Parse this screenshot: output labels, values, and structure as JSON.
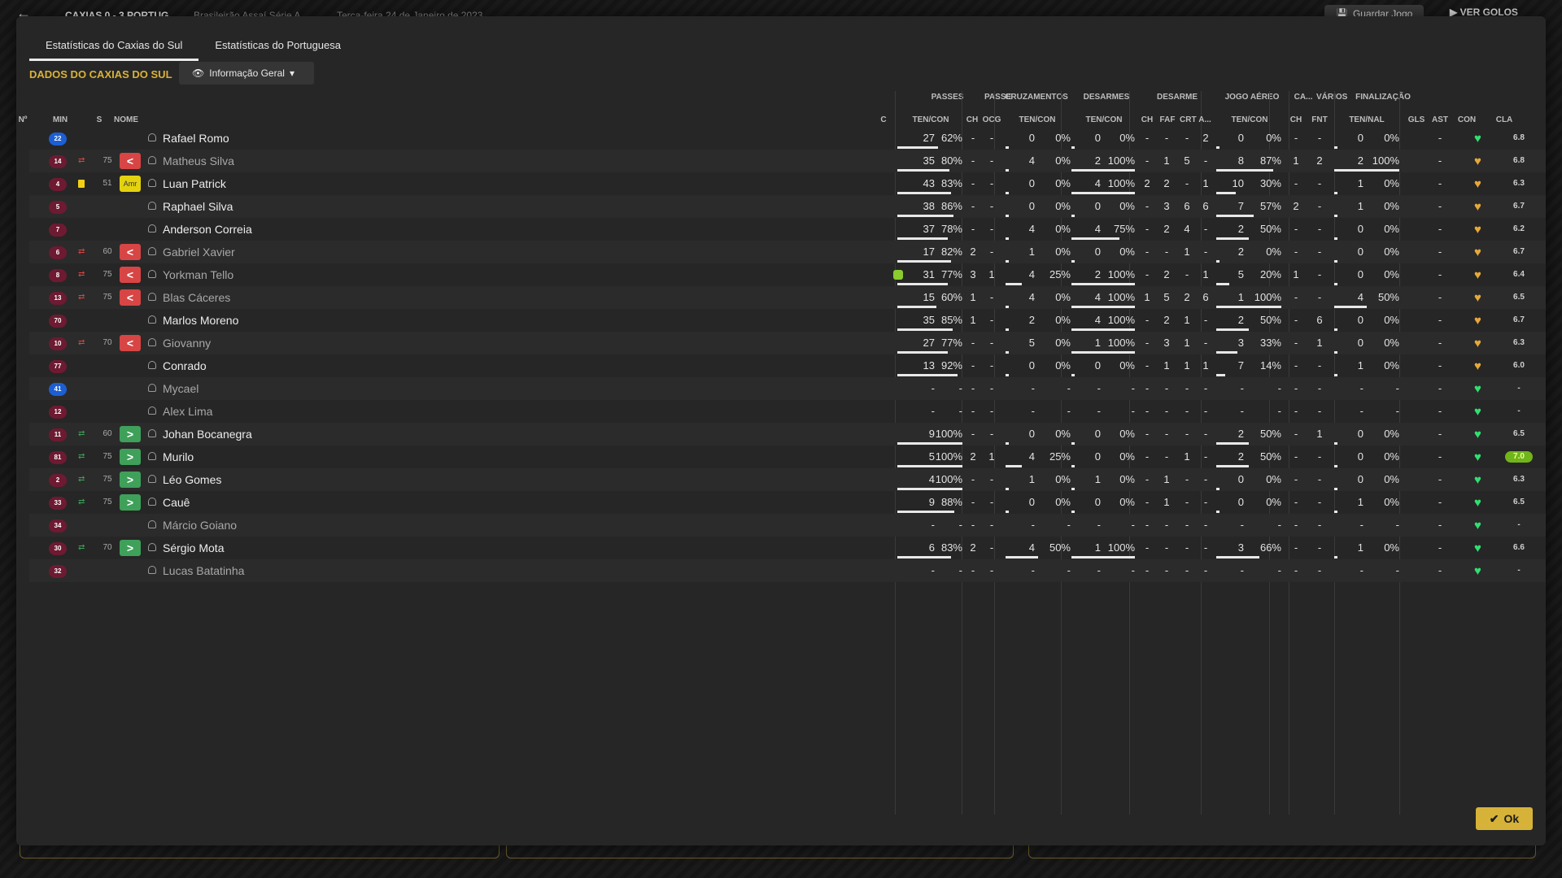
{
  "topbar": {
    "match": "CAXIAS 0 - 3 PORTUG",
    "competition": "Brasileirão Assaí Série A",
    "date": "Terça-feira 24 de Janeiro de 2023",
    "save_label": "Guardar Jogo",
    "goals_label": "VER GOLOS"
  },
  "tabs": [
    {
      "label": "Estatísticas do Caxias do Sul",
      "active": true
    },
    {
      "label": "Estatísticas do Portuguesa",
      "active": false
    }
  ],
  "section_title": "DADOS DO CAXIAS DO SUL",
  "view_select": {
    "label": "Informação Geral"
  },
  "ok_label": "Ok",
  "column_groups": {
    "passes": "PASSES",
    "passe": "PASSE",
    "cruzamentos": "CRUZAMENTOS",
    "desarmes": "DESARMES",
    "desarme": "DESARME",
    "jogo_aereo": "JOGO AÉREO",
    "ca": "CA...",
    "varios": "VÁRIOS",
    "finalizacao": "FINALIZAÇÃO"
  },
  "column_headers": {
    "num": "Nº",
    "min": "MIN",
    "s": "S",
    "nome": "NOME",
    "c": "C",
    "passes_tc": "TEN/CON",
    "passe_ch": "CH",
    "passe_ocg": "OCG",
    "cruz_tc": "TEN/CON",
    "desar_tc": "TEN/CON",
    "d_ch": "CH",
    "d_faf": "FAF",
    "d_crt": "CRT",
    "d_a": "A...",
    "aereo_tc": "TEN/CON",
    "ca_ch": "CH",
    "fnt": "FNT",
    "fin_tn": "TEN/NAL",
    "gls": "GLS",
    "ast": "AST",
    "con": "CON",
    "cla": "CLA"
  },
  "players": [
    {
      "num": "22",
      "gk": true,
      "sub": "",
      "min": "",
      "s": "",
      "s_label": "",
      "name": "Rafael Romo",
      "starter": true,
      "yellow": false,
      "cond": false,
      "pas": [
        "27",
        "62%"
      ],
      "pas_pct": 62,
      "pch": "-",
      "pocg": "-",
      "cru": [
        "0",
        "0%"
      ],
      "cru_pct": 0,
      "des": [
        "0",
        "0%"
      ],
      "des_pct": 0,
      "dch": "-",
      "faf": "-",
      "crt": "-",
      "da": "2",
      "aer": [
        "0",
        "0%"
      ],
      "aer_pct": 0,
      "cach": "-",
      "fnt": "-",
      "fin": [
        "0",
        "0%"
      ],
      "fin_pct": 0,
      "gls": "",
      "ast": "-",
      "con": "green",
      "cla": "6.8",
      "best": false
    },
    {
      "num": "14",
      "gk": false,
      "sub": "out",
      "min": "75",
      "s": "out",
      "s_label": "<",
      "name": "Matheus Silva",
      "starter": false,
      "yellow": false,
      "cond": false,
      "pas": [
        "35",
        "80%"
      ],
      "pas_pct": 80,
      "pch": "-",
      "pocg": "-",
      "cru": [
        "4",
        "0%"
      ],
      "cru_pct": 0,
      "des": [
        "2",
        "100%"
      ],
      "des_pct": 100,
      "dch": "-",
      "faf": "1",
      "crt": "5",
      "da": "-",
      "aer": [
        "8",
        "87%"
      ],
      "aer_pct": 87,
      "cach": "1",
      "fnt": "2",
      "fin": [
        "2",
        "100%"
      ],
      "fin_pct": 100,
      "gls": "",
      "ast": "-",
      "con": "gold",
      "cla": "6.8",
      "best": false
    },
    {
      "num": "4",
      "gk": false,
      "sub": "",
      "min": "51",
      "s": "amr",
      "s_label": "Amr",
      "name": "Luan Patrick",
      "starter": true,
      "yellow": true,
      "cond": false,
      "pas": [
        "43",
        "83%"
      ],
      "pas_pct": 83,
      "pch": "-",
      "pocg": "-",
      "cru": [
        "0",
        "0%"
      ],
      "cru_pct": 0,
      "des": [
        "4",
        "100%"
      ],
      "des_pct": 100,
      "dch": "2",
      "faf": "2",
      "crt": "-",
      "da": "1",
      "aer": [
        "10",
        "30%"
      ],
      "aer_pct": 30,
      "cach": "-",
      "fnt": "-",
      "fin": [
        "1",
        "0%"
      ],
      "fin_pct": 0,
      "gls": "",
      "ast": "-",
      "con": "gold",
      "cla": "6.3",
      "best": false
    },
    {
      "num": "5",
      "gk": false,
      "sub": "",
      "min": "",
      "s": "",
      "s_label": "",
      "name": "Raphael Silva",
      "starter": true,
      "yellow": false,
      "cond": false,
      "pas": [
        "38",
        "86%"
      ],
      "pas_pct": 86,
      "pch": "-",
      "pocg": "-",
      "cru": [
        "0",
        "0%"
      ],
      "cru_pct": 0,
      "des": [
        "0",
        "0%"
      ],
      "des_pct": 0,
      "dch": "-",
      "faf": "3",
      "crt": "6",
      "da": "6",
      "aer": [
        "7",
        "57%"
      ],
      "aer_pct": 57,
      "cach": "2",
      "fnt": "-",
      "fin": [
        "1",
        "0%"
      ],
      "fin_pct": 0,
      "gls": "",
      "ast": "-",
      "con": "gold",
      "cla": "6.7",
      "best": false
    },
    {
      "num": "7",
      "gk": false,
      "sub": "",
      "min": "",
      "s": "",
      "s_label": "",
      "name": "Anderson Correia",
      "starter": true,
      "yellow": false,
      "cond": false,
      "pas": [
        "37",
        "78%"
      ],
      "pas_pct": 78,
      "pch": "-",
      "pocg": "-",
      "cru": [
        "4",
        "0%"
      ],
      "cru_pct": 0,
      "des": [
        "4",
        "75%"
      ],
      "des_pct": 75,
      "dch": "-",
      "faf": "2",
      "crt": "4",
      "da": "-",
      "aer": [
        "2",
        "50%"
      ],
      "aer_pct": 50,
      "cach": "-",
      "fnt": "-",
      "fin": [
        "0",
        "0%"
      ],
      "fin_pct": 0,
      "gls": "",
      "ast": "-",
      "con": "gold",
      "cla": "6.2",
      "best": false
    },
    {
      "num": "6",
      "gk": false,
      "sub": "out",
      "min": "60",
      "s": "out",
      "s_label": "<",
      "name": "Gabriel Xavier",
      "starter": false,
      "yellow": false,
      "cond": false,
      "pas": [
        "17",
        "82%"
      ],
      "pas_pct": 82,
      "pch": "2",
      "pocg": "-",
      "cru": [
        "1",
        "0%"
      ],
      "cru_pct": 0,
      "des": [
        "0",
        "0%"
      ],
      "des_pct": 0,
      "dch": "-",
      "faf": "-",
      "crt": "1",
      "da": "-",
      "aer": [
        "2",
        "0%"
      ],
      "aer_pct": 0,
      "cach": "-",
      "fnt": "-",
      "fin": [
        "0",
        "0%"
      ],
      "fin_pct": 0,
      "gls": "",
      "ast": "-",
      "con": "gold",
      "cla": "6.7",
      "best": false
    },
    {
      "num": "8",
      "gk": false,
      "sub": "out",
      "min": "75",
      "s": "out",
      "s_label": "<",
      "name": "Yorkman Tello",
      "starter": false,
      "yellow": false,
      "cond": true,
      "pas": [
        "31",
        "77%"
      ],
      "pas_pct": 77,
      "pch": "3",
      "pocg": "1",
      "cru": [
        "4",
        "25%"
      ],
      "cru_pct": 25,
      "des": [
        "2",
        "100%"
      ],
      "des_pct": 100,
      "dch": "-",
      "faf": "2",
      "crt": "-",
      "da": "1",
      "aer": [
        "5",
        "20%"
      ],
      "aer_pct": 20,
      "cach": "1",
      "fnt": "-",
      "fin": [
        "0",
        "0%"
      ],
      "fin_pct": 0,
      "gls": "",
      "ast": "-",
      "con": "gold",
      "cla": "6.4",
      "best": false
    },
    {
      "num": "13",
      "gk": false,
      "sub": "out",
      "min": "75",
      "s": "out",
      "s_label": "<",
      "name": "Blas Cáceres",
      "starter": false,
      "yellow": false,
      "cond": false,
      "pas": [
        "15",
        "60%"
      ],
      "pas_pct": 60,
      "pch": "1",
      "pocg": "-",
      "cru": [
        "4",
        "0%"
      ],
      "cru_pct": 0,
      "des": [
        "4",
        "100%"
      ],
      "des_pct": 100,
      "dch": "1",
      "faf": "5",
      "crt": "2",
      "da": "6",
      "aer": [
        "1",
        "100%"
      ],
      "aer_pct": 100,
      "cach": "-",
      "fnt": "-",
      "fin": [
        "4",
        "50%"
      ],
      "fin_pct": 50,
      "gls": "",
      "ast": "-",
      "con": "gold",
      "cla": "6.5",
      "best": false
    },
    {
      "num": "70",
      "gk": false,
      "sub": "",
      "min": "",
      "s": "",
      "s_label": "",
      "name": "Marlos Moreno",
      "starter": true,
      "yellow": false,
      "cond": false,
      "pas": [
        "35",
        "85%"
      ],
      "pas_pct": 85,
      "pch": "1",
      "pocg": "-",
      "cru": [
        "2",
        "0%"
      ],
      "cru_pct": 0,
      "des": [
        "4",
        "100%"
      ],
      "des_pct": 100,
      "dch": "-",
      "faf": "2",
      "crt": "1",
      "da": "-",
      "aer": [
        "2",
        "50%"
      ],
      "aer_pct": 50,
      "cach": "-",
      "fnt": "6",
      "fin": [
        "0",
        "0%"
      ],
      "fin_pct": 0,
      "gls": "",
      "ast": "-",
      "con": "gold",
      "cla": "6.7",
      "best": false
    },
    {
      "num": "10",
      "gk": false,
      "sub": "out",
      "min": "70",
      "s": "out",
      "s_label": "<",
      "name": "Giovanny",
      "starter": false,
      "yellow": false,
      "cond": false,
      "pas": [
        "27",
        "77%"
      ],
      "pas_pct": 77,
      "pch": "-",
      "pocg": "-",
      "cru": [
        "5",
        "0%"
      ],
      "cru_pct": 0,
      "des": [
        "1",
        "100%"
      ],
      "des_pct": 100,
      "dch": "-",
      "faf": "3",
      "crt": "1",
      "da": "-",
      "aer": [
        "3",
        "33%"
      ],
      "aer_pct": 33,
      "cach": "-",
      "fnt": "1",
      "fin": [
        "0",
        "0%"
      ],
      "fin_pct": 0,
      "gls": "",
      "ast": "-",
      "con": "gold",
      "cla": "6.3",
      "best": false
    },
    {
      "num": "77",
      "gk": false,
      "sub": "",
      "min": "",
      "s": "",
      "s_label": "",
      "name": "Conrado",
      "starter": true,
      "yellow": false,
      "cond": false,
      "pas": [
        "13",
        "92%"
      ],
      "pas_pct": 92,
      "pch": "-",
      "pocg": "-",
      "cru": [
        "0",
        "0%"
      ],
      "cru_pct": 0,
      "des": [
        "0",
        "0%"
      ],
      "des_pct": 0,
      "dch": "-",
      "faf": "1",
      "crt": "1",
      "da": "1",
      "aer": [
        "7",
        "14%"
      ],
      "aer_pct": 14,
      "cach": "-",
      "fnt": "-",
      "fin": [
        "1",
        "0%"
      ],
      "fin_pct": 0,
      "gls": "",
      "ast": "-",
      "con": "gold",
      "cla": "6.0",
      "best": false
    },
    {
      "num": "41",
      "gk": true,
      "sub": "",
      "min": "",
      "s": "",
      "s_label": "",
      "name": "Mycael",
      "starter": false,
      "yellow": false,
      "cond": false,
      "pas": [
        "-",
        "-"
      ],
      "pas_pct": 0,
      "pch": "-",
      "pocg": "-",
      "cru": [
        "-",
        "-"
      ],
      "cru_pct": 0,
      "des": [
        "-",
        "-"
      ],
      "des_pct": 0,
      "dch": "-",
      "faf": "-",
      "crt": "-",
      "da": "-",
      "aer": [
        "-",
        "-"
      ],
      "aer_pct": 0,
      "cach": "-",
      "fnt": "-",
      "fin": [
        "-",
        "-"
      ],
      "fin_pct": 0,
      "gls": "",
      "ast": "-",
      "con": "green",
      "cla": "-",
      "best": false
    },
    {
      "num": "12",
      "gk": false,
      "sub": "",
      "min": "",
      "s": "",
      "s_label": "",
      "name": "Alex Lima",
      "starter": false,
      "yellow": false,
      "cond": false,
      "pas": [
        "-",
        "-"
      ],
      "pas_pct": 0,
      "pch": "-",
      "pocg": "-",
      "cru": [
        "-",
        "-"
      ],
      "cru_pct": 0,
      "des": [
        "-",
        "-"
      ],
      "des_pct": 0,
      "dch": "-",
      "faf": "-",
      "crt": "-",
      "da": "-",
      "aer": [
        "-",
        "-"
      ],
      "aer_pct": 0,
      "cach": "-",
      "fnt": "-",
      "fin": [
        "-",
        "-"
      ],
      "fin_pct": 0,
      "gls": "",
      "ast": "-",
      "con": "green",
      "cla": "-",
      "best": false
    },
    {
      "num": "11",
      "gk": false,
      "sub": "in",
      "min": "60",
      "s": "in",
      "s_label": ">",
      "name": "Johan Bocanegra",
      "starter": true,
      "yellow": false,
      "cond": false,
      "pas": [
        "9",
        "100%"
      ],
      "pas_pct": 100,
      "pch": "-",
      "pocg": "-",
      "cru": [
        "0",
        "0%"
      ],
      "cru_pct": 0,
      "des": [
        "0",
        "0%"
      ],
      "des_pct": 0,
      "dch": "-",
      "faf": "-",
      "crt": "-",
      "da": "-",
      "aer": [
        "2",
        "50%"
      ],
      "aer_pct": 50,
      "cach": "-",
      "fnt": "1",
      "fin": [
        "0",
        "0%"
      ],
      "fin_pct": 0,
      "gls": "",
      "ast": "-",
      "con": "green",
      "cla": "6.5",
      "best": false
    },
    {
      "num": "81",
      "gk": false,
      "sub": "in",
      "min": "75",
      "s": "in",
      "s_label": ">",
      "name": "Murilo",
      "starter": true,
      "yellow": false,
      "cond": false,
      "pas": [
        "5",
        "100%"
      ],
      "pas_pct": 100,
      "pch": "2",
      "pocg": "1",
      "cru": [
        "4",
        "25%"
      ],
      "cru_pct": 25,
      "des": [
        "0",
        "0%"
      ],
      "des_pct": 0,
      "dch": "-",
      "faf": "-",
      "crt": "1",
      "da": "-",
      "aer": [
        "2",
        "50%"
      ],
      "aer_pct": 50,
      "cach": "-",
      "fnt": "-",
      "fin": [
        "0",
        "0%"
      ],
      "fin_pct": 0,
      "gls": "",
      "ast": "-",
      "con": "green",
      "cla": "7.0",
      "best": true
    },
    {
      "num": "2",
      "gk": false,
      "sub": "in",
      "min": "75",
      "s": "in",
      "s_label": ">",
      "name": "Léo Gomes",
      "starter": true,
      "yellow": false,
      "cond": false,
      "pas": [
        "4",
        "100%"
      ],
      "pas_pct": 100,
      "pch": "-",
      "pocg": "-",
      "cru": [
        "1",
        "0%"
      ],
      "cru_pct": 0,
      "des": [
        "1",
        "0%"
      ],
      "des_pct": 0,
      "dch": "-",
      "faf": "1",
      "crt": "-",
      "da": "-",
      "aer": [
        "0",
        "0%"
      ],
      "aer_pct": 0,
      "cach": "-",
      "fnt": "-",
      "fin": [
        "0",
        "0%"
      ],
      "fin_pct": 0,
      "gls": "",
      "ast": "-",
      "con": "green",
      "cla": "6.3",
      "best": false
    },
    {
      "num": "33",
      "gk": false,
      "sub": "in",
      "min": "75",
      "s": "in",
      "s_label": ">",
      "name": "Cauê",
      "starter": true,
      "yellow": false,
      "cond": false,
      "pas": [
        "9",
        "88%"
      ],
      "pas_pct": 88,
      "pch": "-",
      "pocg": "-",
      "cru": [
        "0",
        "0%"
      ],
      "cru_pct": 0,
      "des": [
        "0",
        "0%"
      ],
      "des_pct": 0,
      "dch": "-",
      "faf": "1",
      "crt": "-",
      "da": "-",
      "aer": [
        "0",
        "0%"
      ],
      "aer_pct": 0,
      "cach": "-",
      "fnt": "-",
      "fin": [
        "1",
        "0%"
      ],
      "fin_pct": 0,
      "gls": "",
      "ast": "-",
      "con": "green",
      "cla": "6.5",
      "best": false
    },
    {
      "num": "34",
      "gk": false,
      "sub": "",
      "min": "",
      "s": "",
      "s_label": "",
      "name": "Márcio Goiano",
      "starter": false,
      "yellow": false,
      "cond": false,
      "pas": [
        "-",
        "-"
      ],
      "pas_pct": 0,
      "pch": "-",
      "pocg": "-",
      "cru": [
        "-",
        "-"
      ],
      "cru_pct": 0,
      "des": [
        "-",
        "-"
      ],
      "des_pct": 0,
      "dch": "-",
      "faf": "-",
      "crt": "-",
      "da": "-",
      "aer": [
        "-",
        "-"
      ],
      "aer_pct": 0,
      "cach": "-",
      "fnt": "-",
      "fin": [
        "-",
        "-"
      ],
      "fin_pct": 0,
      "gls": "",
      "ast": "-",
      "con": "green",
      "cla": "-",
      "best": false
    },
    {
      "num": "30",
      "gk": false,
      "sub": "in",
      "min": "70",
      "s": "in",
      "s_label": ">",
      "name": "Sérgio Mota",
      "starter": true,
      "yellow": false,
      "cond": false,
      "pas": [
        "6",
        "83%"
      ],
      "pas_pct": 83,
      "pch": "2",
      "pocg": "-",
      "cru": [
        "4",
        "50%"
      ],
      "cru_pct": 50,
      "des": [
        "1",
        "100%"
      ],
      "des_pct": 100,
      "dch": "-",
      "faf": "-",
      "crt": "-",
      "da": "-",
      "aer": [
        "3",
        "66%"
      ],
      "aer_pct": 66,
      "cach": "-",
      "fnt": "-",
      "fin": [
        "1",
        "0%"
      ],
      "fin_pct": 0,
      "gls": "",
      "ast": "-",
      "con": "green",
      "cla": "6.6",
      "best": false
    },
    {
      "num": "32",
      "gk": false,
      "sub": "",
      "min": "",
      "s": "",
      "s_label": "",
      "name": "Lucas Batatinha",
      "starter": false,
      "yellow": false,
      "cond": false,
      "pas": [
        "-",
        "-"
      ],
      "pas_pct": 0,
      "pch": "-",
      "pocg": "-",
      "cru": [
        "-",
        "-"
      ],
      "cru_pct": 0,
      "des": [
        "-",
        "-"
      ],
      "des_pct": 0,
      "dch": "-",
      "faf": "-",
      "crt": "-",
      "da": "-",
      "aer": [
        "-",
        "-"
      ],
      "aer_pct": 0,
      "cach": "-",
      "fnt": "-",
      "fin": [
        "-",
        "-"
      ],
      "fin_pct": 0,
      "gls": "",
      "ast": "-",
      "con": "green",
      "cla": "-",
      "best": false
    }
  ]
}
